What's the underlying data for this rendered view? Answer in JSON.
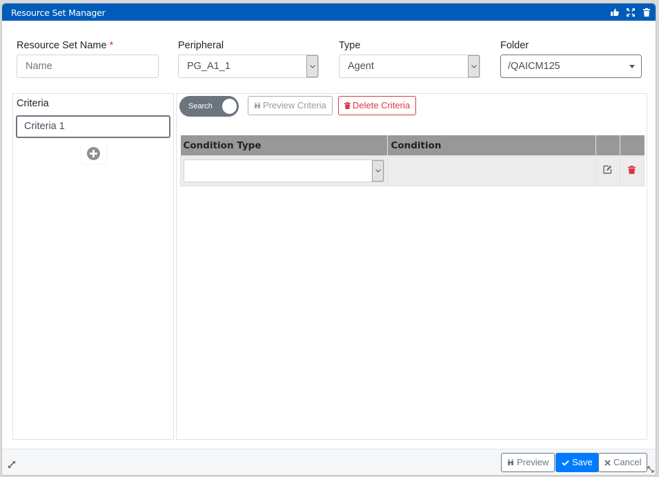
{
  "window": {
    "title": "Resource Set Manager",
    "title_icons": [
      "thumbs-up-icon",
      "expand-icon",
      "trash-icon"
    ]
  },
  "form": {
    "name": {
      "label": "Resource Set Name",
      "required_marker": "*",
      "value": "",
      "placeholder": "Name"
    },
    "peripheral": {
      "label": "Peripheral",
      "value": "PG_A1_1"
    },
    "type": {
      "label": "Type",
      "value": "Agent"
    },
    "folder": {
      "label": "Folder",
      "value": "/QAICM125"
    }
  },
  "criteria_panel": {
    "label": "Criteria",
    "items": [
      {
        "label": "Criteria 1",
        "selected": true
      }
    ],
    "add_icon": "plus-circle-icon"
  },
  "criteria_editor": {
    "search_toggle": {
      "label": "Search",
      "on": true
    },
    "preview_criteria_label": "Preview Criteria",
    "delete_criteria_label": "Delete Criteria",
    "table": {
      "columns": [
        "Condition Type",
        "Condition",
        "",
        ""
      ],
      "rows": [
        {
          "condition_type": "",
          "condition": "",
          "actions": [
            "edit-icon",
            "trash-icon"
          ]
        }
      ]
    }
  },
  "footer": {
    "preview_label": "Preview",
    "save_label": "Save",
    "cancel_label": "Cancel"
  },
  "colors": {
    "titlebar": "#005cb9",
    "primary": "#007bff",
    "danger": "#dc3545",
    "secondary": "#6c757d",
    "table_header": "#989898"
  }
}
